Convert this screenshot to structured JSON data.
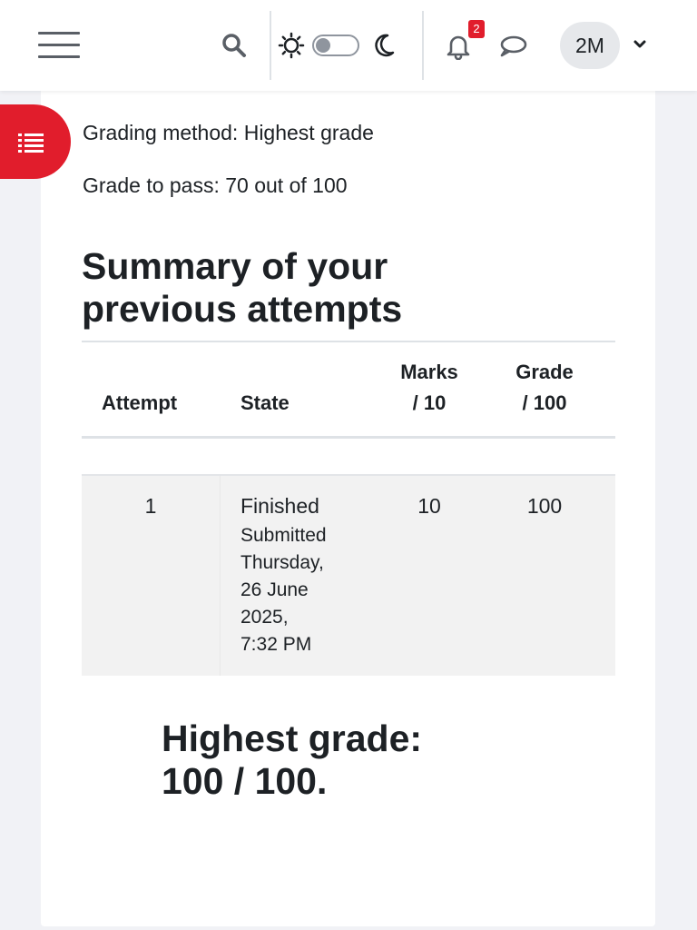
{
  "header": {
    "notification_count": "2",
    "user_initials": "2M"
  },
  "quiz_info": {
    "grading_method": "Grading method: Highest grade",
    "grade_to_pass": "Grade to pass: 70 out of 100"
  },
  "summary": {
    "heading_line1": "Summary of your",
    "heading_line2": "previous attempts",
    "columns": {
      "attempt": "Attempt",
      "state": "State",
      "marks_1": "Marks",
      "marks_2": "/ 10",
      "grade_1": "Grade",
      "grade_2": "/ 100"
    },
    "rows": [
      {
        "attempt": "1",
        "state": "Finished",
        "submitted": "Submitted",
        "date_1": "Thursday,",
        "date_2": "26 June",
        "date_3": "2025,",
        "date_4": "7:32 PM",
        "marks": "10",
        "grade": "100"
      }
    ]
  },
  "result": {
    "line1": "Highest grade:",
    "line2": "100 / 100."
  },
  "icons": {
    "menu": "hamburger-menu-icon",
    "search": "search-icon",
    "light_mode": "sun-icon",
    "dark_mode": "moon-icon",
    "notifications": "bell-icon",
    "messages": "chat-bubble-icon",
    "user_menu": "chevron-down-icon",
    "course_index": "list-icon"
  },
  "colors": {
    "accent": "#e11d2c",
    "text": "#1d2125",
    "row_background": "#f2f2f2",
    "page_background": "#f1f2f6"
  }
}
